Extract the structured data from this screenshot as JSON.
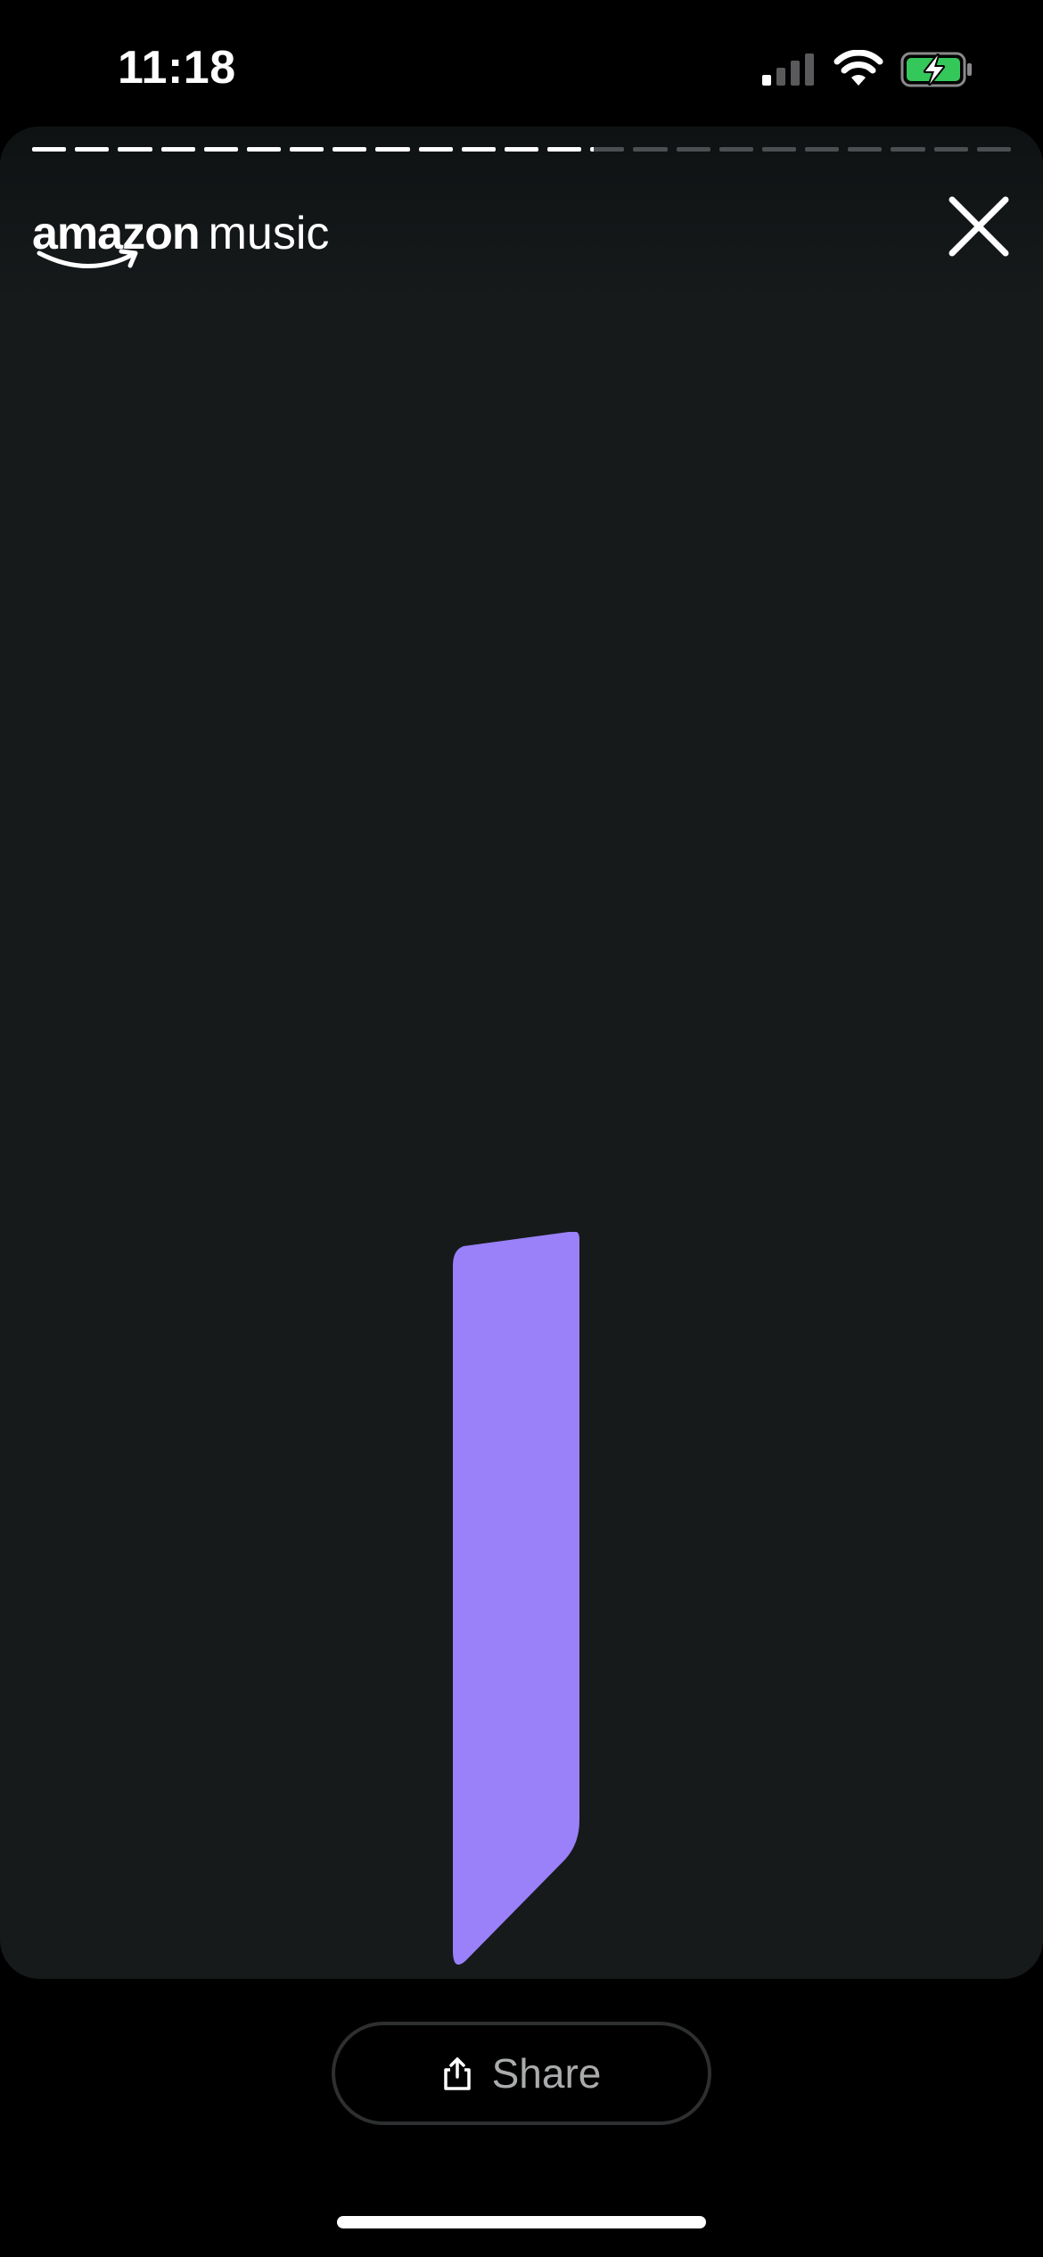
{
  "status_bar": {
    "time": "11:18",
    "signal_icon": "cellular-signal-icon",
    "wifi_icon": "wifi-icon",
    "battery_icon": "battery-charging-icon",
    "battery_color": "#34c759"
  },
  "story": {
    "progress": {
      "segment_count": 23,
      "completed_segments": 13,
      "current_segment_fraction": 0.1
    },
    "logo": {
      "brand": "amazon",
      "product": "music"
    },
    "close_icon": "close-icon",
    "background_color": "#161a1b",
    "shape_color": "#9a80f9"
  },
  "share_button": {
    "label": "Share",
    "icon": "share-icon"
  }
}
